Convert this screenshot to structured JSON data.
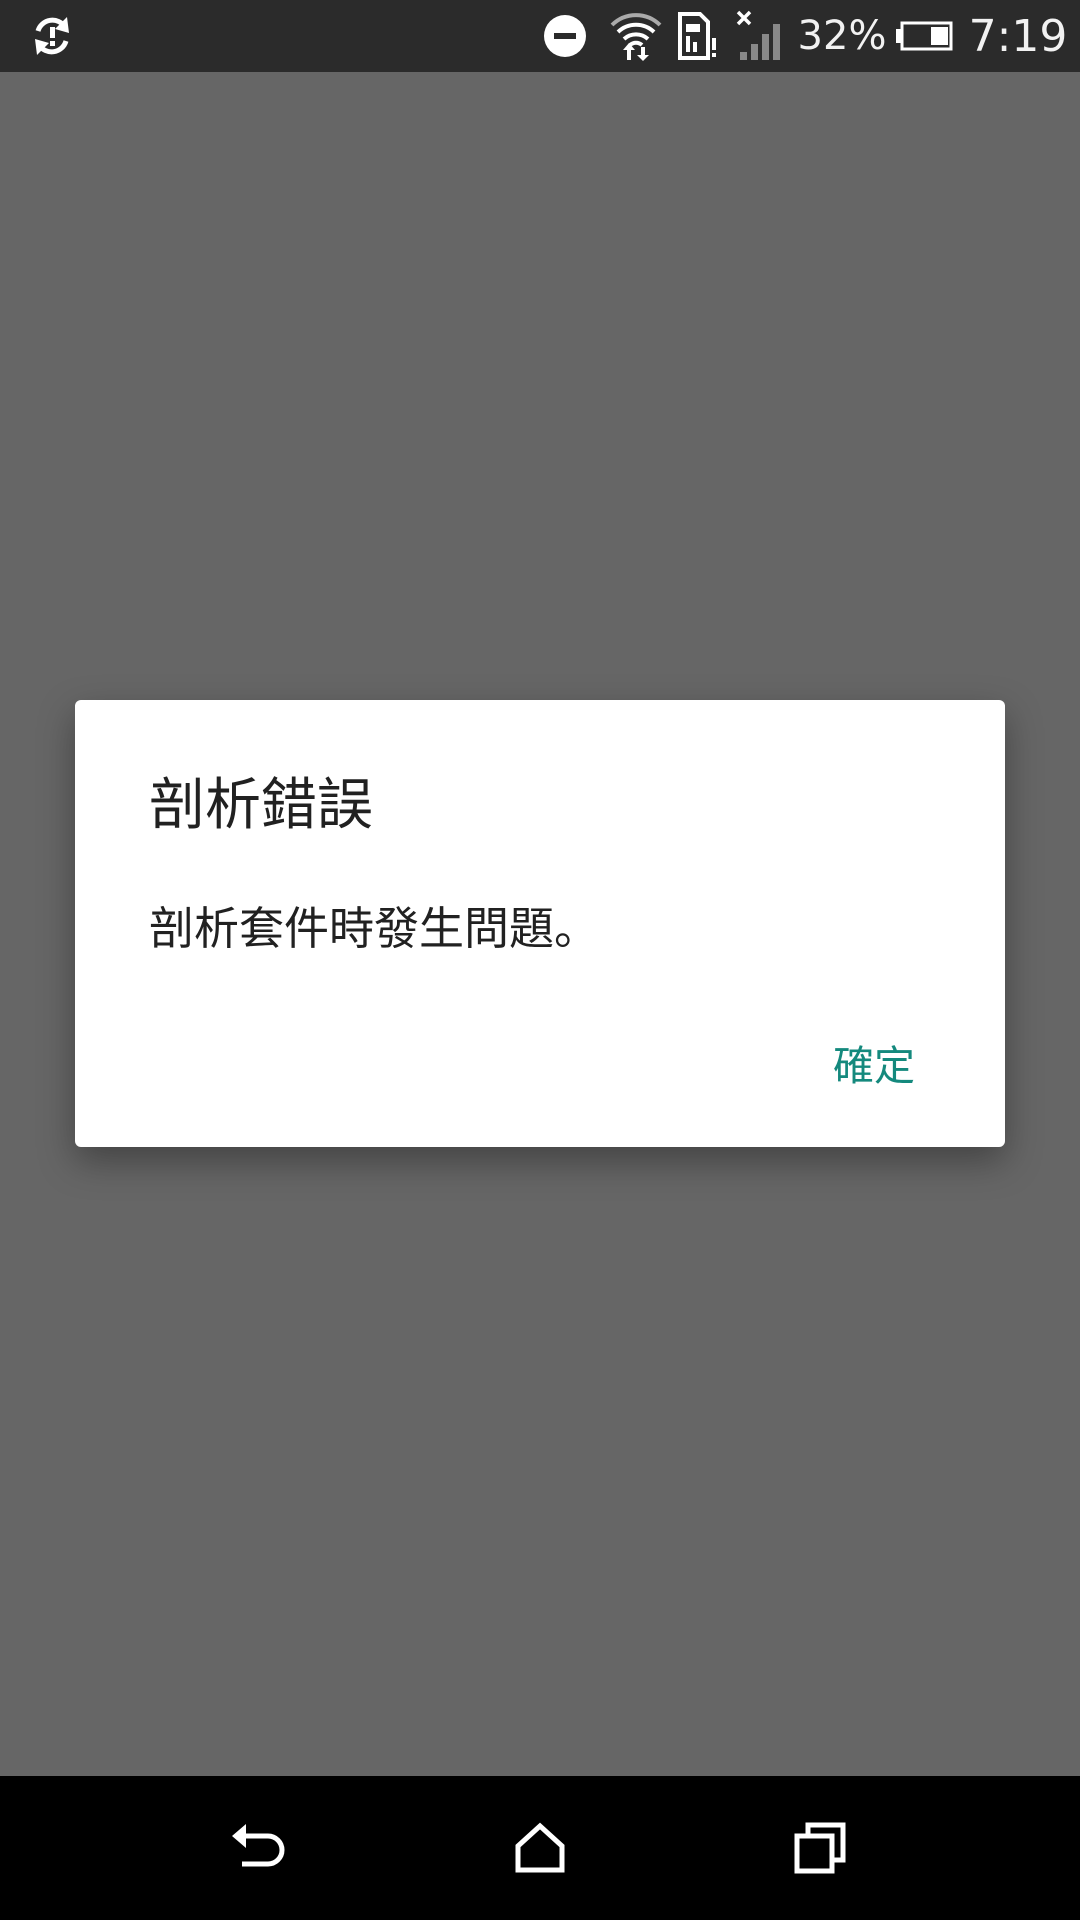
{
  "status_bar": {
    "icons": {
      "sync": "sync-icon",
      "dnd": "do-not-disturb-icon",
      "wifi": "wifi-icon",
      "sim": "sim-card-alert-icon",
      "signal": "cell-signal-none-icon",
      "battery": "battery-icon"
    },
    "battery_percent": "32%",
    "time": "7:19"
  },
  "dialog": {
    "title": "剖析錯誤",
    "message": "剖析套件時發生問題。",
    "ok_label": "確定"
  },
  "nav_bar": {
    "icons": {
      "back": "back-icon",
      "home": "home-icon",
      "recents": "recents-icon"
    }
  },
  "colors": {
    "scrim": "#666666",
    "status_bar": "#2b2b2b",
    "dialog_bg": "#ffffff",
    "accent": "#14897d",
    "nav_bar": "#000000"
  }
}
